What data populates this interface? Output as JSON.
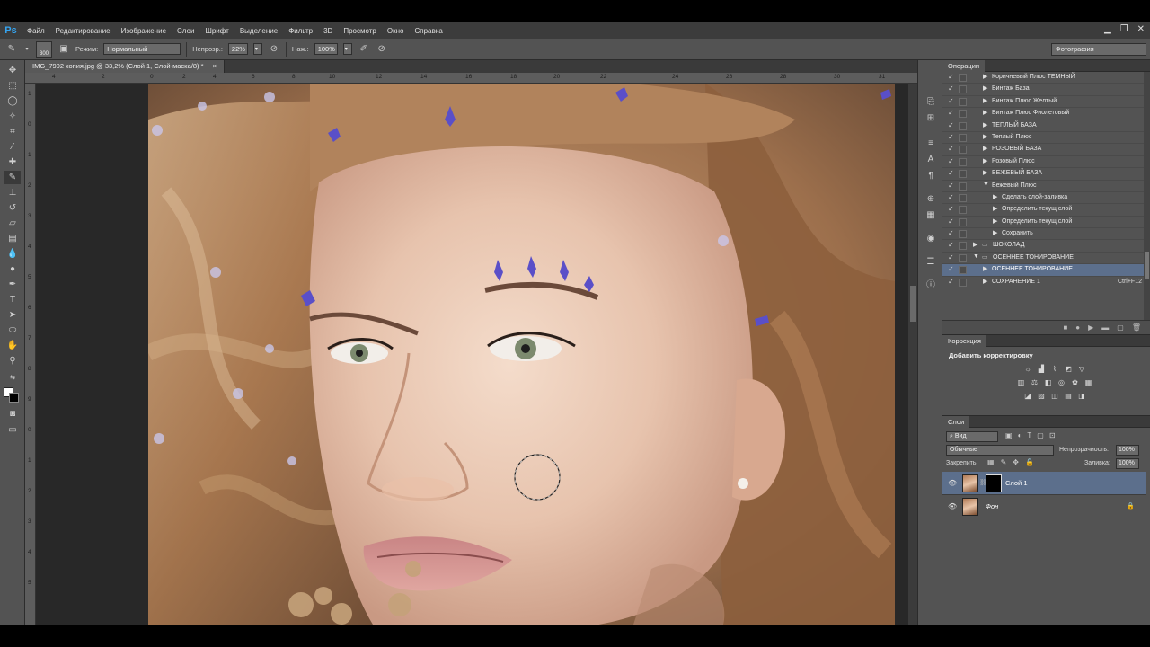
{
  "app": {
    "logo": "Ps"
  },
  "menu": [
    "Файл",
    "Редактирование",
    "Изображение",
    "Слои",
    "Шрифт",
    "Выделение",
    "Фильтр",
    "3D",
    "Просмотр",
    "Окно",
    "Справка"
  ],
  "options": {
    "brush_size": "300",
    "mode_label": "Режим:",
    "mode_value": "Нормальный",
    "opacity_label": "Непрозр.:",
    "opacity_value": "22%",
    "flow_label": "Наж.:",
    "flow_value": "100%",
    "workspace": "Фотография"
  },
  "document": {
    "tab_title": "IMG_7902 копия.jpg @ 33,2% (Слой 1, Слой-маска/8) *",
    "ruler_h": [
      "4",
      "2",
      "0",
      "2",
      "4",
      "6",
      "8",
      "10",
      "12",
      "14",
      "16",
      "18",
      "20",
      "22",
      "24",
      "26",
      "28",
      "30",
      "31"
    ],
    "ruler_v": [
      "1",
      "0",
      "1",
      "2",
      "3",
      "4",
      "5",
      "6",
      "7",
      "8",
      "9",
      "0",
      "1",
      "2",
      "3",
      "4",
      "5"
    ]
  },
  "actions_panel": {
    "tab": "Операции",
    "rows": [
      {
        "level": 1,
        "expand": "right",
        "label": "Коричневый Плюс ТЕМНЫЙ",
        "red": false
      },
      {
        "level": 1,
        "expand": "right",
        "label": "Винтаж База",
        "red": true
      },
      {
        "level": 1,
        "expand": "right",
        "label": "Винтаж Плюс Желтый",
        "red": false
      },
      {
        "level": 1,
        "expand": "right",
        "label": "Винтаж Плюс Фиолетовый",
        "red": false
      },
      {
        "level": 1,
        "expand": "right",
        "label": "ТЕПЛЫЙ БАЗА",
        "red": false
      },
      {
        "level": 1,
        "expand": "right",
        "label": "Теплый Плюс",
        "red": false
      },
      {
        "level": 1,
        "expand": "right",
        "label": "РОЗОВЫЙ БАЗА",
        "red": true
      },
      {
        "level": 1,
        "expand": "right",
        "label": "Розовый Плюс",
        "red": false
      },
      {
        "level": 1,
        "expand": "right",
        "label": "БЕЖЕВЫЙ БАЗА",
        "red": false
      },
      {
        "level": 1,
        "expand": "down",
        "label": "Бежевый Плюс",
        "red": false
      },
      {
        "level": 2,
        "expand": "right",
        "label": "Сделать слой-заливка",
        "red": false
      },
      {
        "level": 2,
        "expand": "right",
        "label": "Определить текущ слой",
        "red": false
      },
      {
        "level": 2,
        "expand": "right",
        "label": "Определить текущ слой",
        "red": false
      },
      {
        "level": 2,
        "expand": "right",
        "label": "Сохранить",
        "red": false
      },
      {
        "level": 0,
        "expand": "right",
        "label": "ШОКОЛАД",
        "red": false,
        "folder": true
      },
      {
        "level": 0,
        "expand": "down",
        "label": "ОСЕННЕЕ ТОНИРОВАНИЕ",
        "red": false,
        "folder": true
      },
      {
        "level": 1,
        "expand": "right",
        "label": "ОСЕННЕЕ ТОНИРОВАНИЕ",
        "red": false,
        "selected": true
      },
      {
        "level": 1,
        "expand": "right",
        "label": "СОХРАНЕНИЕ 1",
        "red": false,
        "shortcut": "Ctrl+F12"
      }
    ]
  },
  "adjustments_panel": {
    "tab": "Коррекция",
    "title": "Добавить корректировку"
  },
  "layers_panel": {
    "tab": "Слои",
    "filter": "Вид",
    "blend_mode": "Обычные",
    "opacity_label": "Непрозрачность:",
    "opacity_value": "100%",
    "lock_label": "Закрепить:",
    "fill_label": "Заливка:",
    "fill_value": "100%",
    "layers": [
      {
        "name": "Слой 1",
        "selected": true,
        "mask": true
      },
      {
        "name": "Фон",
        "selected": false,
        "locked": true
      }
    ]
  },
  "colors": {
    "panel": "#535353",
    "selection": "#5c6f8c",
    "ps_blue": "#35a4f0"
  }
}
